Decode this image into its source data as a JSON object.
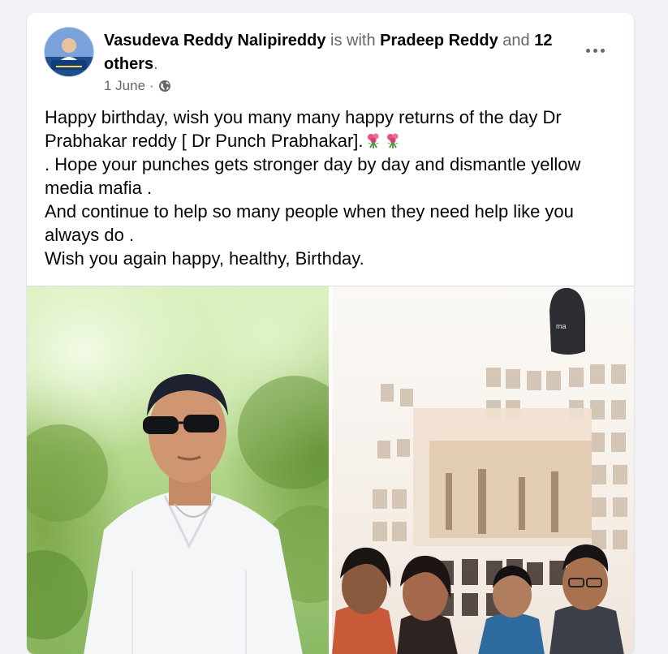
{
  "post": {
    "author": "Vasudeva Reddy Nalipireddy",
    "with_text": " is with ",
    "tagged_person": "Pradeep Reddy",
    "and_text": " and ",
    "others": "12 others",
    "period": ".",
    "date": "1 June",
    "date_separator": "·",
    "audience_icon": "globe-icon",
    "more_icon": "more-options-icon",
    "body_lines": [
      "Happy birthday, wish you many many happy returns of the day Dr Prabhakar reddy [ Dr Punch Prabhakar].",
      ". Hope your punches gets stronger day by day and dismantle yellow media mafia .",
      "And continue to help so many people when they need help like you always do .",
      "Wish you again happy, healthy, Birthday."
    ],
    "emoji_icon": "bouquet-icon",
    "photos": [
      {
        "name": "photo-left",
        "description_icon": "portrait-photo"
      },
      {
        "name": "photo-right",
        "description_icon": "group-photo"
      }
    ]
  },
  "colors": {
    "background": "#f0f2f5",
    "card": "#ffffff",
    "primary_text": "#050505",
    "secondary_text": "#65676b"
  }
}
